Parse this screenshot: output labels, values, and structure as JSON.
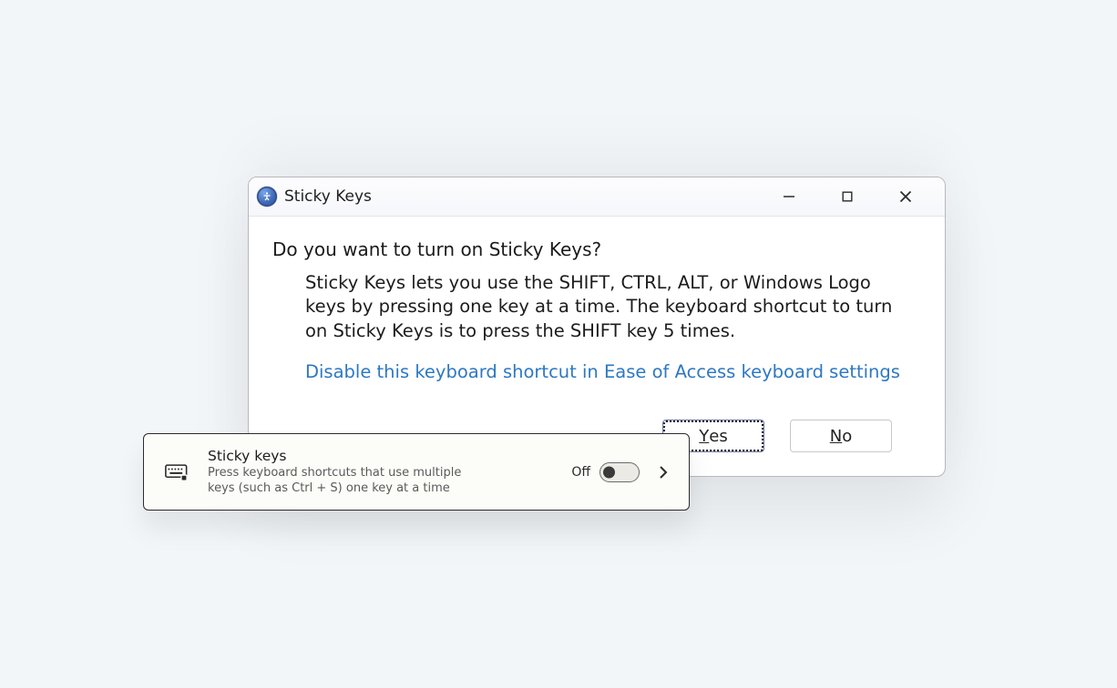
{
  "dialog": {
    "title": "Sticky Keys",
    "heading": "Do you want to turn on Sticky Keys?",
    "body": "Sticky Keys lets you use the SHIFT, CTRL, ALT, or Windows Logo keys by pressing one key at a time. The keyboard shortcut to turn on Sticky Keys is to press the SHIFT key 5 times.",
    "link": "Disable this keyboard shortcut in Ease of Access keyboard settings",
    "buttons": {
      "yes_prefix": "Y",
      "yes_suffix": "es",
      "no_prefix": "N",
      "no_suffix": "o"
    }
  },
  "tile": {
    "title": "Sticky keys",
    "description": "Press keyboard shortcuts that use multiple keys (such as Ctrl + S) one key at a time",
    "state_label": "Off"
  }
}
